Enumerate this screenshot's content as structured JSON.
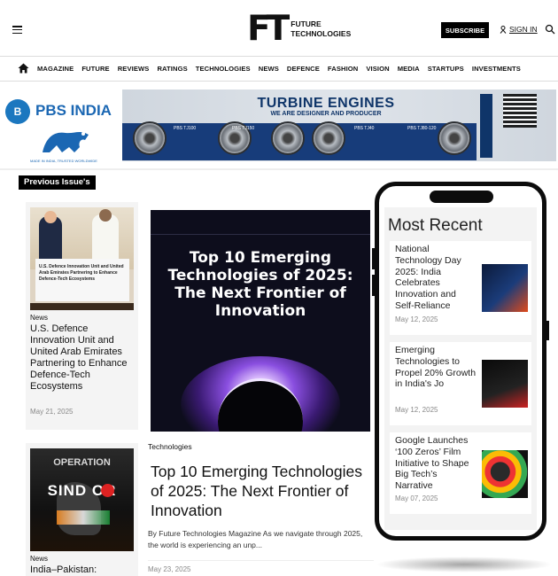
{
  "header": {
    "logo_mark": "FT",
    "logo_line1": "FUTURE",
    "logo_line2": "TECHNOLOGIES",
    "subscribe_label": "SUBSCRIBE",
    "signin_label": "SIGN IN"
  },
  "nav": {
    "items": [
      "MAGAZINE",
      "FUTURE",
      "REVIEWS",
      "RATINGS",
      "TECHNOLOGIES",
      "NEWS",
      "DEFENCE",
      "FASHION",
      "VISION",
      "MEDIA",
      "STARTUPS",
      "INVESTMENTS"
    ]
  },
  "banner": {
    "brand": "PBS INDIA",
    "brand_badge": "B",
    "brand_tag": "MADE IN INDIA, TRUSTED WORLDWIDE",
    "ad_title": "TURBINE ENGINES",
    "ad_subtitle": "WE ARE DESIGNER AND PRODUCER",
    "models": [
      "PBS TJ100",
      "PBS TJ150",
      "PBS TJ40",
      "PBS TJ80-120"
    ]
  },
  "previous": {
    "label": "Previous Issue's",
    "cards": [
      {
        "category": "News",
        "title": "U.S. Defence Innovation Unit and United Arab Emirates Partnering to Enhance Defence-Tech Ecosystems",
        "date": "May 21, 2025",
        "image_caption": "U.S. Defence Innovation Unit and United Arab Emirates Partnering to Enhance Defence-Tech Ecosystems"
      },
      {
        "category": "News",
        "title": "India–Pakistan:",
        "image_word1": "OPERATION",
        "image_word2": "SIND  OR"
      }
    ]
  },
  "featured": {
    "image_headline": "Top 10 Emerging Technologies of 2025: The Next Frontier of Innovation",
    "category": "Technologies",
    "title": "Top 10 Emerging Technologies of 2025: The Next Frontier of Innovation",
    "excerpt": "By Future Technologies Magazine As we navigate through 2025, the world is experiencing an unp...",
    "date": "May 23, 2025"
  },
  "most_recent": {
    "heading": "Most Recent",
    "items": [
      {
        "title": "National Technology Day 2025: India Celebrates Innovation and Self-Reliance",
        "date": "May 12, 2025"
      },
      {
        "title": "Emerging Technologies to Propel 20% Growth in India's Jo",
        "date": "May 12, 2025"
      },
      {
        "title": "Google Launches ‘100 Zeros’ Film Initiative to Shape Big Tech’s Narrative",
        "date": "May 07, 2025"
      }
    ]
  },
  "colors": {
    "brand_blue": "#1b67b3",
    "ad_navy": "#0f3569",
    "feature_bg": "#0d0d1c"
  }
}
